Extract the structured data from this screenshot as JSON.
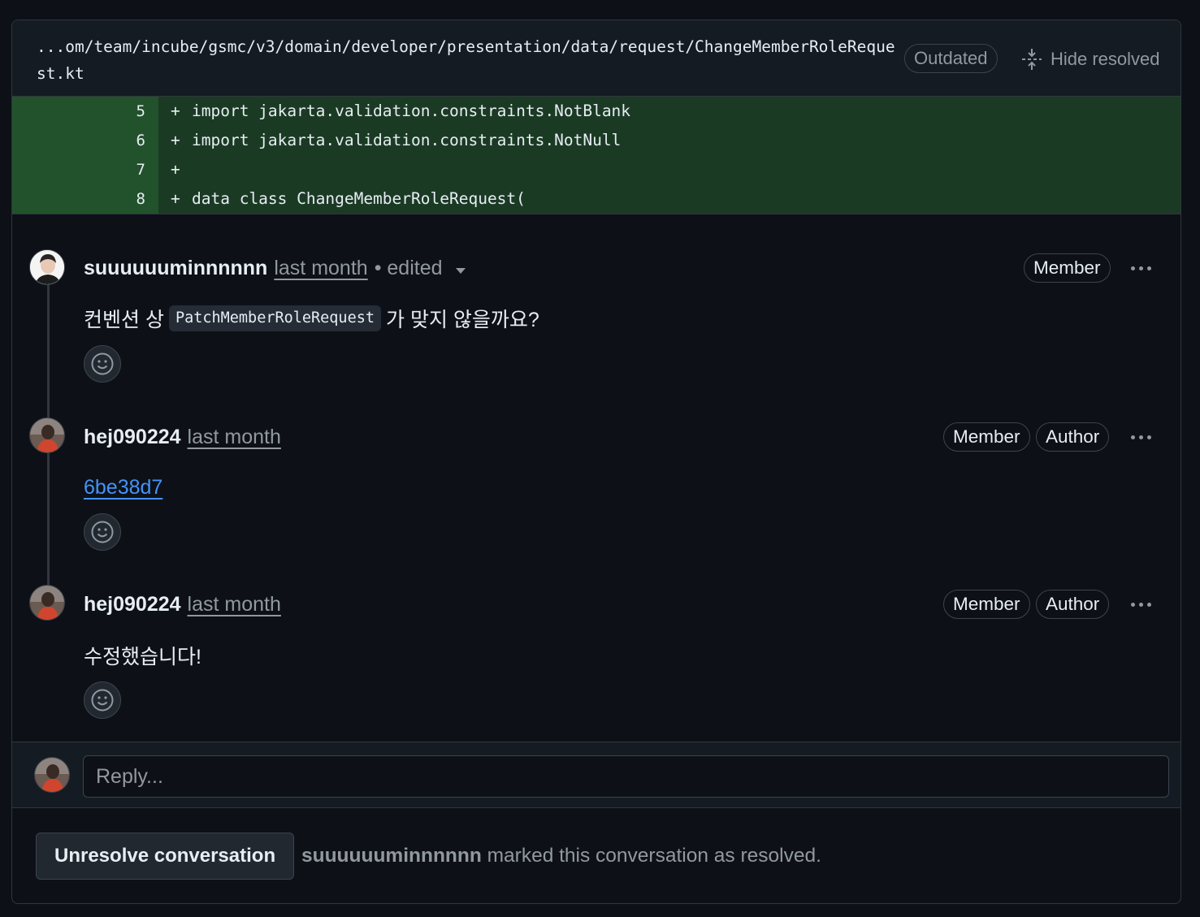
{
  "file": {
    "path": "...om/team/incube/gsmc/v3/domain/developer/presentation/data/request/ChangeMemberRoleRequest.kt",
    "outdated_label": "Outdated",
    "hide_resolved_label": "Hide resolved"
  },
  "diff": {
    "lines": [
      {
        "num": "5",
        "sign": "+",
        "code": "import jakarta.validation.constraints.NotBlank"
      },
      {
        "num": "6",
        "sign": "+",
        "code": "import jakarta.validation.constraints.NotNull"
      },
      {
        "num": "7",
        "sign": "+",
        "code": ""
      },
      {
        "num": "8",
        "sign": "+",
        "code": "data class ChangeMemberRoleRequest("
      }
    ]
  },
  "comments": [
    {
      "author": "suuuuuuminnnnnn",
      "time": "last month",
      "edited": "• edited",
      "badges": [
        "Member"
      ],
      "body_before": "컨벤션 상",
      "body_code": "PatchMemberRoleRequest",
      "body_after": "가 맞지 않을까요?"
    },
    {
      "author": "hej090224",
      "time": "last month",
      "badges": [
        "Member",
        "Author"
      ],
      "commit": "6be38d7"
    },
    {
      "author": "hej090224",
      "time": "last month",
      "badges": [
        "Member",
        "Author"
      ],
      "body": "수정했습니다!"
    }
  ],
  "reply": {
    "placeholder": "Reply..."
  },
  "footer": {
    "unresolve_label": "Unresolve conversation",
    "resolver": "suuuuuuminnnnnn",
    "resolved_text": "marked this conversation as resolved."
  },
  "colors": {
    "background": "#0d1117",
    "diff_added": "#1b3a24",
    "diff_gutter": "#22522c",
    "link": "#4493f8",
    "muted": "#9198a1"
  }
}
